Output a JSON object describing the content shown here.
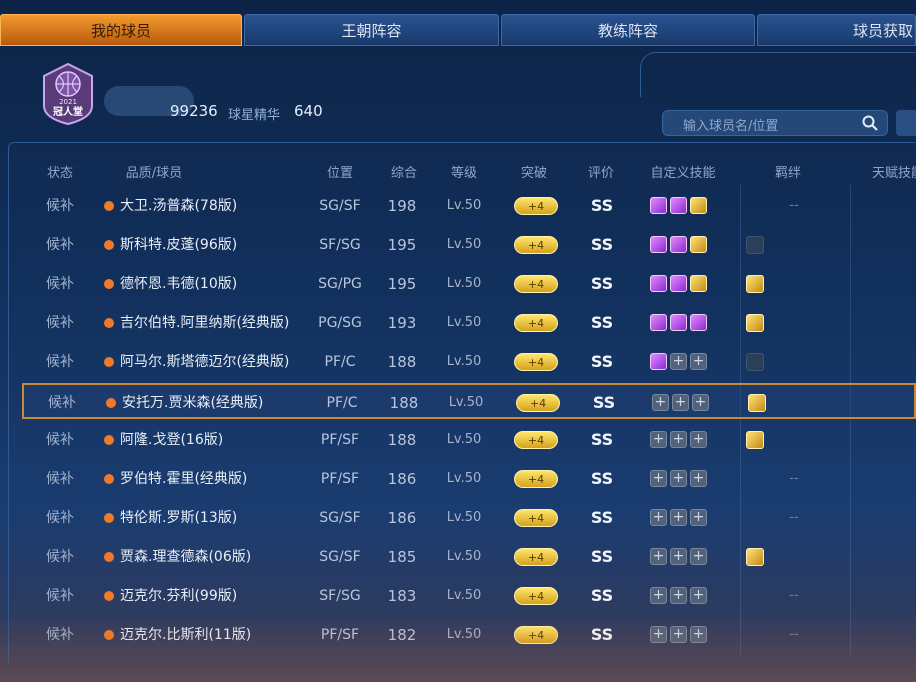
{
  "tabs": [
    {
      "label": "我的球员",
      "active": true
    },
    {
      "label": "王朝阵容",
      "active": false
    },
    {
      "label": "教练阵容",
      "active": false
    },
    {
      "label": "球员获取",
      "active": false
    }
  ],
  "profile": {
    "badge_text": "2021",
    "badge_title": "冠人堂",
    "stat1_value": "99236",
    "stat2_label": "球星精华",
    "stat2_value": "640"
  },
  "search": {
    "placeholder": "输入球员名/位置"
  },
  "headers": {
    "status": "状态",
    "name": "品质/球员",
    "position": "位置",
    "overall": "综合",
    "level": "等级",
    "breakthrough": "突破",
    "rating": "评价",
    "skills": "自定义技能",
    "bond": "羁绊",
    "talent": "天赋技能"
  },
  "players": [
    {
      "status": "候补",
      "name": "大卫.汤普森(78版)",
      "pos": "SG/SF",
      "ovr": "198",
      "lv": "Lv.50",
      "brk": "+4",
      "rate": "SS",
      "skills": [
        "purple",
        "purple",
        "gold"
      ],
      "bond": "none",
      "dash": "--"
    },
    {
      "status": "候补",
      "name": "斯科特.皮蓬(96版)",
      "pos": "SF/SG",
      "ovr": "195",
      "lv": "Lv.50",
      "brk": "+4",
      "rate": "SS",
      "skills": [
        "purple",
        "purple",
        "gold"
      ],
      "bond": "grey",
      "dash": ""
    },
    {
      "status": "候补",
      "name": "德怀恩.韦德(10版)",
      "pos": "SG/PG",
      "ovr": "195",
      "lv": "Lv.50",
      "brk": "+4",
      "rate": "SS",
      "skills": [
        "purple",
        "purple",
        "gold"
      ],
      "bond": "gold",
      "dash": ""
    },
    {
      "status": "候补",
      "name": "吉尔伯特.阿里纳斯(经典版)",
      "pos": "PG/SG",
      "ovr": "193",
      "lv": "Lv.50",
      "brk": "+4",
      "rate": "SS",
      "skills": [
        "purple",
        "purple",
        "purple"
      ],
      "bond": "gold",
      "dash": ""
    },
    {
      "status": "候补",
      "name": "阿马尔.斯塔德迈尔(经典版)",
      "pos": "PF/C",
      "ovr": "188",
      "lv": "Lv.50",
      "brk": "+4",
      "rate": "SS",
      "skills": [
        "purple",
        "empty",
        "empty"
      ],
      "bond": "grey",
      "dash": ""
    },
    {
      "status": "候补",
      "name": "安托万.贾米森(经典版)",
      "pos": "PF/C",
      "ovr": "188",
      "lv": "Lv.50",
      "brk": "+4",
      "rate": "SS",
      "skills": [
        "empty",
        "empty",
        "empty"
      ],
      "bond": "gold",
      "dash": "",
      "selected": true
    },
    {
      "status": "候补",
      "name": "阿隆.戈登(16版)",
      "pos": "PF/SF",
      "ovr": "188",
      "lv": "Lv.50",
      "brk": "+4",
      "rate": "SS",
      "skills": [
        "empty",
        "empty",
        "empty"
      ],
      "bond": "gold",
      "dash": ""
    },
    {
      "status": "候补",
      "name": "罗伯特.霍里(经典版)",
      "pos": "PF/SF",
      "ovr": "186",
      "lv": "Lv.50",
      "brk": "+4",
      "rate": "SS",
      "skills": [
        "empty",
        "empty",
        "empty"
      ],
      "bond": "none",
      "dash": "--"
    },
    {
      "status": "候补",
      "name": "特伦斯.罗斯(13版)",
      "pos": "SG/SF",
      "ovr": "186",
      "lv": "Lv.50",
      "brk": "+4",
      "rate": "SS",
      "skills": [
        "empty",
        "empty",
        "empty"
      ],
      "bond": "none",
      "dash": "--"
    },
    {
      "status": "候补",
      "name": "贾森.理查德森(06版)",
      "pos": "SG/SF",
      "ovr": "185",
      "lv": "Lv.50",
      "brk": "+4",
      "rate": "SS",
      "skills": [
        "empty",
        "empty",
        "empty"
      ],
      "bond": "gold",
      "dash": ""
    },
    {
      "status": "候补",
      "name": "迈克尔.芬利(99版)",
      "pos": "SF/SG",
      "ovr": "183",
      "lv": "Lv.50",
      "brk": "+4",
      "rate": "SS",
      "skills": [
        "empty",
        "empty",
        "empty"
      ],
      "bond": "none",
      "dash": "--"
    },
    {
      "status": "候补",
      "name": "迈克尔.比斯利(11版)",
      "pos": "PF/SF",
      "ovr": "182",
      "lv": "Lv.50",
      "brk": "+4",
      "rate": "SS",
      "skills": [
        "empty",
        "empty",
        "empty"
      ],
      "bond": "none",
      "dash": "--"
    }
  ]
}
